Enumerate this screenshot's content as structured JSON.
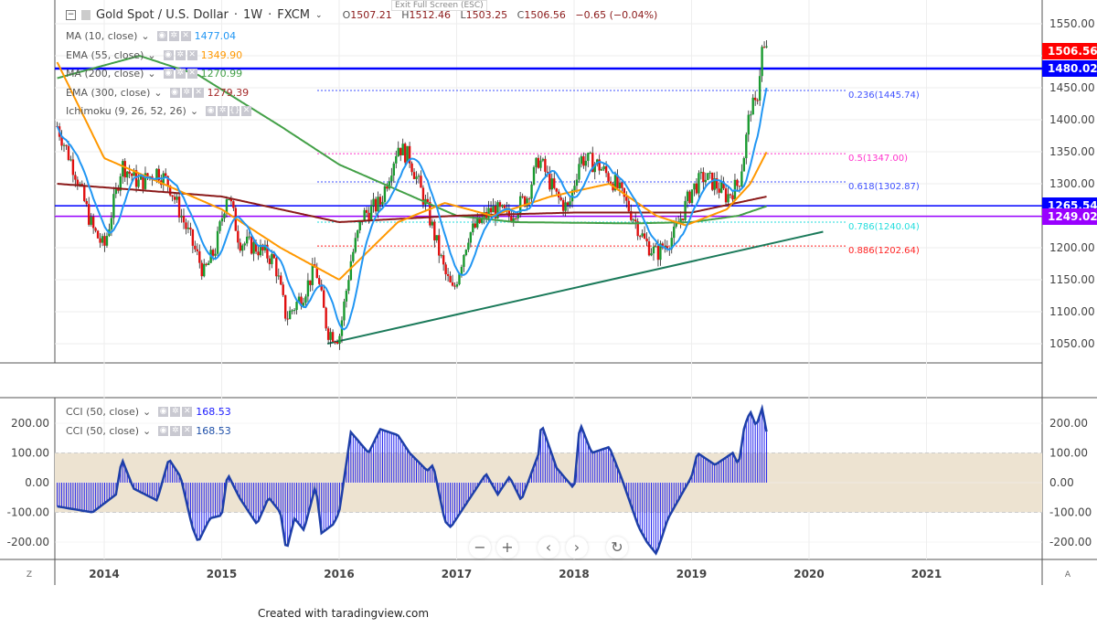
{
  "header": {
    "symbol": "Gold Spot / U.S. Dollar",
    "interval": "1W",
    "exchange": "FXCM",
    "open_label": "O",
    "open": "1507.21",
    "high_label": "H",
    "high": "1512.46",
    "low_label": "L",
    "low": "1503.25",
    "close_label": "C",
    "close": "1506.56",
    "change": "−0.65 (−0.04%)",
    "exit_fullscreen": "Exit Full Screen (ESC)"
  },
  "indicators": [
    {
      "label": "MA (10, close)",
      "value": "1477.04",
      "color": "#2196f3"
    },
    {
      "label": "EMA (55, close)",
      "value": "1349.90",
      "color": "#ff9800"
    },
    {
      "label": "MA (200, close)",
      "value": "1270.99",
      "color": "#43a047"
    },
    {
      "label": "EMA (300, close)",
      "value": "1279.39",
      "color": "#a52a2a"
    },
    {
      "label": "Ichimoku (9, 26, 52, 26)",
      "value": "",
      "color": "#999999"
    }
  ],
  "cci_legends": [
    {
      "label": "CCI (50, close)",
      "value": "168.53",
      "color": "#1a1aff"
    },
    {
      "label": "CCI (50, close)",
      "value": "168.53",
      "color": "#1e4fa8"
    }
  ],
  "price_tags": [
    {
      "value": "1506.56",
      "price": 1506.56,
      "color": "#ff0000"
    },
    {
      "value": "1480.02",
      "price": 1480.02,
      "color": "#0000ff"
    },
    {
      "value": "1265.54",
      "price": 1265.54,
      "color": "#0000ff"
    },
    {
      "value": "1249.02",
      "price": 1249.02,
      "color": "#9900ff"
    }
  ],
  "fib_levels": [
    {
      "label": "0.236(1445.74)",
      "price": 1445.74,
      "color": "#3f51ff"
    },
    {
      "label": "0.5(1347.00)",
      "price": 1347.0,
      "color": "#ff33cc"
    },
    {
      "label": "0.618(1302.87)",
      "price": 1302.87,
      "color": "#3f51ff"
    },
    {
      "label": "0.786(1240.04)",
      "price": 1240.04,
      "color": "#22dddd"
    },
    {
      "label": "0.886(1202.64)",
      "price": 1202.64,
      "color": "#ff2222"
    }
  ],
  "nav_buttons": [
    "−",
    "+",
    "‹",
    "›",
    "↻"
  ],
  "axis_corner_left": "Z",
  "axis_corner_right": "A",
  "footer": "Created with taradingview.com",
  "chart_data": {
    "type": "candlestick",
    "title": "Gold Spot / U.S. Dollar · 1W · FXCM",
    "x_ticks": [
      "2014",
      "2015",
      "2016",
      "2017",
      "2018",
      "2019",
      "2020",
      "2021"
    ],
    "x_range": [
      2013.6,
      2021.98
    ],
    "price_ticks": [
      "1050.00",
      "1100.00",
      "1150.00",
      "1200.00",
      "1250.00",
      "1300.00",
      "1350.00",
      "1400.00",
      "1450.00",
      "1500.00",
      "1550.00"
    ],
    "price_range": [
      1010,
      1565
    ],
    "close_series": [
      [
        2013.6,
        1390
      ],
      [
        2013.75,
        1320
      ],
      [
        2013.9,
        1230
      ],
      [
        2014.0,
        1200
      ],
      [
        2014.15,
        1330
      ],
      [
        2014.3,
        1300
      ],
      [
        2014.45,
        1320
      ],
      [
        2014.55,
        1300
      ],
      [
        2014.7,
        1230
      ],
      [
        2014.85,
        1160
      ],
      [
        2014.95,
        1200
      ],
      [
        2015.05,
        1290
      ],
      [
        2015.15,
        1210
      ],
      [
        2015.3,
        1200
      ],
      [
        2015.45,
        1180
      ],
      [
        2015.55,
        1090
      ],
      [
        2015.7,
        1130
      ],
      [
        2015.8,
        1170
      ],
      [
        2015.9,
        1070
      ],
      [
        2016.0,
        1060
      ],
      [
        2016.1,
        1180
      ],
      [
        2016.2,
        1250
      ],
      [
        2016.35,
        1270
      ],
      [
        2016.5,
        1360
      ],
      [
        2016.6,
        1340
      ],
      [
        2016.75,
        1260
      ],
      [
        2016.9,
        1160
      ],
      [
        2016.97,
        1130
      ],
      [
        2017.1,
        1220
      ],
      [
        2017.3,
        1260
      ],
      [
        2017.45,
        1250
      ],
      [
        2017.6,
        1280
      ],
      [
        2017.7,
        1340
      ],
      [
        2017.85,
        1280
      ],
      [
        2017.95,
        1260
      ],
      [
        2018.05,
        1340
      ],
      [
        2018.2,
        1330
      ],
      [
        2018.35,
        1300
      ],
      [
        2018.5,
        1250
      ],
      [
        2018.6,
        1210
      ],
      [
        2018.7,
        1190
      ],
      [
        2018.85,
        1220
      ],
      [
        2019.0,
        1290
      ],
      [
        2019.1,
        1310
      ],
      [
        2019.2,
        1300
      ],
      [
        2019.3,
        1280
      ],
      [
        2019.4,
        1300
      ],
      [
        2019.45,
        1350
      ],
      [
        2019.5,
        1420
      ],
      [
        2019.55,
        1420
      ],
      [
        2019.6,
        1510
      ],
      [
        2019.64,
        1506.56
      ]
    ],
    "ema55": [
      [
        2013.6,
        1490
      ],
      [
        2014.0,
        1340
      ],
      [
        2014.5,
        1300
      ],
      [
        2015.0,
        1260
      ],
      [
        2015.5,
        1200
      ],
      [
        2016.0,
        1150
      ],
      [
        2016.5,
        1240
      ],
      [
        2016.9,
        1270
      ],
      [
        2017.3,
        1250
      ],
      [
        2017.8,
        1280
      ],
      [
        2018.3,
        1300
      ],
      [
        2018.7,
        1250
      ],
      [
        2018.95,
        1235
      ],
      [
        2019.3,
        1260
      ],
      [
        2019.5,
        1300
      ],
      [
        2019.64,
        1350
      ]
    ],
    "ma200": [
      [
        2013.6,
        1465
      ],
      [
        2014.3,
        1500
      ],
      [
        2014.8,
        1470
      ],
      [
        2015.5,
        1390
      ],
      [
        2016.0,
        1330
      ],
      [
        2016.5,
        1290
      ],
      [
        2017.0,
        1250
      ],
      [
        2017.5,
        1240
      ],
      [
        2018.5,
        1238
      ],
      [
        2019.0,
        1240
      ],
      [
        2019.4,
        1250
      ],
      [
        2019.64,
        1265
      ]
    ],
    "ema300": [
      [
        2013.6,
        1300
      ],
      [
        2015.0,
        1280
      ],
      [
        2016.0,
        1240
      ],
      [
        2017.0,
        1250
      ],
      [
        2018.0,
        1255
      ],
      [
        2019.0,
        1255
      ],
      [
        2019.64,
        1280
      ]
    ],
    "trendline": [
      [
        2015.9,
        1050
      ],
      [
        2020.12,
        1225
      ]
    ],
    "cci": {
      "ticks": [
        "200.00",
        "100.00",
        "0.00",
        "-100.00",
        "-200.00"
      ],
      "range": [
        -260,
        280
      ],
      "band": [
        -100,
        100
      ],
      "series": [
        [
          2013.6,
          -80
        ],
        [
          2013.9,
          -100
        ],
        [
          2014.1,
          -40
        ],
        [
          2014.15,
          80
        ],
        [
          2014.25,
          -20
        ],
        [
          2014.45,
          -60
        ],
        [
          2014.55,
          80
        ],
        [
          2014.65,
          20
        ],
        [
          2014.75,
          -150
        ],
        [
          2014.8,
          -200
        ],
        [
          2014.9,
          -120
        ],
        [
          2015.0,
          -110
        ],
        [
          2015.05,
          30
        ],
        [
          2015.15,
          -50
        ],
        [
          2015.3,
          -140
        ],
        [
          2015.4,
          -50
        ],
        [
          2015.5,
          -100
        ],
        [
          2015.55,
          -230
        ],
        [
          2015.62,
          -120
        ],
        [
          2015.7,
          -160
        ],
        [
          2015.8,
          -10
        ],
        [
          2015.85,
          -170
        ],
        [
          2015.95,
          -140
        ],
        [
          2016.0,
          -100
        ],
        [
          2016.1,
          170
        ],
        [
          2016.25,
          100
        ],
        [
          2016.35,
          180
        ],
        [
          2016.5,
          160
        ],
        [
          2016.6,
          100
        ],
        [
          2016.75,
          40
        ],
        [
          2016.8,
          60
        ],
        [
          2016.9,
          -130
        ],
        [
          2016.95,
          -150
        ],
        [
          2017.1,
          -60
        ],
        [
          2017.25,
          30
        ],
        [
          2017.35,
          -40
        ],
        [
          2017.45,
          20
        ],
        [
          2017.55,
          -60
        ],
        [
          2017.7,
          100
        ],
        [
          2017.72,
          200
        ],
        [
          2017.85,
          50
        ],
        [
          2018.0,
          -20
        ],
        [
          2018.05,
          200
        ],
        [
          2018.15,
          100
        ],
        [
          2018.3,
          120
        ],
        [
          2018.4,
          20
        ],
        [
          2018.55,
          -150
        ],
        [
          2018.62,
          -200
        ],
        [
          2018.7,
          -240
        ],
        [
          2018.8,
          -120
        ],
        [
          2019.0,
          20
        ],
        [
          2019.05,
          100
        ],
        [
          2019.2,
          60
        ],
        [
          2019.35,
          100
        ],
        [
          2019.4,
          60
        ],
        [
          2019.45,
          190
        ],
        [
          2019.5,
          240
        ],
        [
          2019.55,
          190
        ],
        [
          2019.6,
          250
        ],
        [
          2019.64,
          168.53
        ]
      ]
    }
  }
}
